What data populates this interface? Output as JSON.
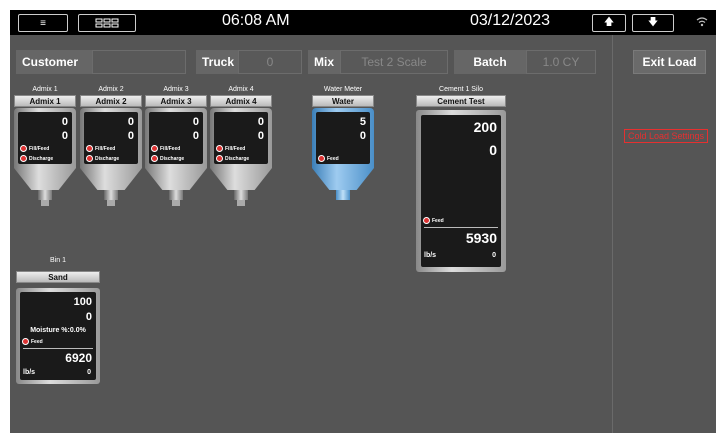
{
  "topbar": {
    "time": "06:08 AM",
    "date": "03/12/2023",
    "menu_icon": "menu-icon",
    "grid_icon": "grid-icon",
    "up_icon": "up-arrow-icon",
    "down_icon": "down-arrow-icon",
    "wifi_icon": "wifi-icon"
  },
  "ticket": {
    "customer_label": "Customer",
    "customer_value": "",
    "truck_label": "Truck",
    "truck_value": "0",
    "mix_label": "Mix",
    "mix_value": "Test 2 Scale",
    "batch_label": "Batch",
    "batch_value": "1.0 CY"
  },
  "exit_load": "Exit Load",
  "cold_load": "Cold Load Settings",
  "admixes": [
    {
      "caption": "Admix 1",
      "name": "Admix 1",
      "v1": "0",
      "v2": "0",
      "ind1": "Fill/Feed",
      "ind2": "Discharge"
    },
    {
      "caption": "Admix 2",
      "name": "Admix 2",
      "v1": "0",
      "v2": "0",
      "ind1": "Fill/Feed",
      "ind2": "Discharge"
    },
    {
      "caption": "Admix 3",
      "name": "Admix 3",
      "v1": "0",
      "v2": "0",
      "ind1": "Fill/Feed",
      "ind2": "Discharge"
    },
    {
      "caption": "Admix 4",
      "name": "Admix 4",
      "v1": "0",
      "v2": "0",
      "ind1": "Fill/Feed",
      "ind2": "Discharge"
    }
  ],
  "water": {
    "caption": "Water Meter",
    "name": "Water",
    "v1": "5",
    "v2": "0",
    "ind": "Feed"
  },
  "cement": {
    "caption": "Cement 1 Silo",
    "name": "Cement Test",
    "target": "200",
    "actual": "0",
    "ind": "Feed",
    "weight": "5930",
    "unit": "lb/s",
    "rate": "0"
  },
  "bin": {
    "caption": "Bin 1",
    "name": "Sand",
    "target": "100",
    "actual": "0",
    "moisture": "Moisture %:0.0%",
    "ind": "Feed",
    "weight": "6920",
    "unit": "lb/s",
    "rate": "0"
  }
}
